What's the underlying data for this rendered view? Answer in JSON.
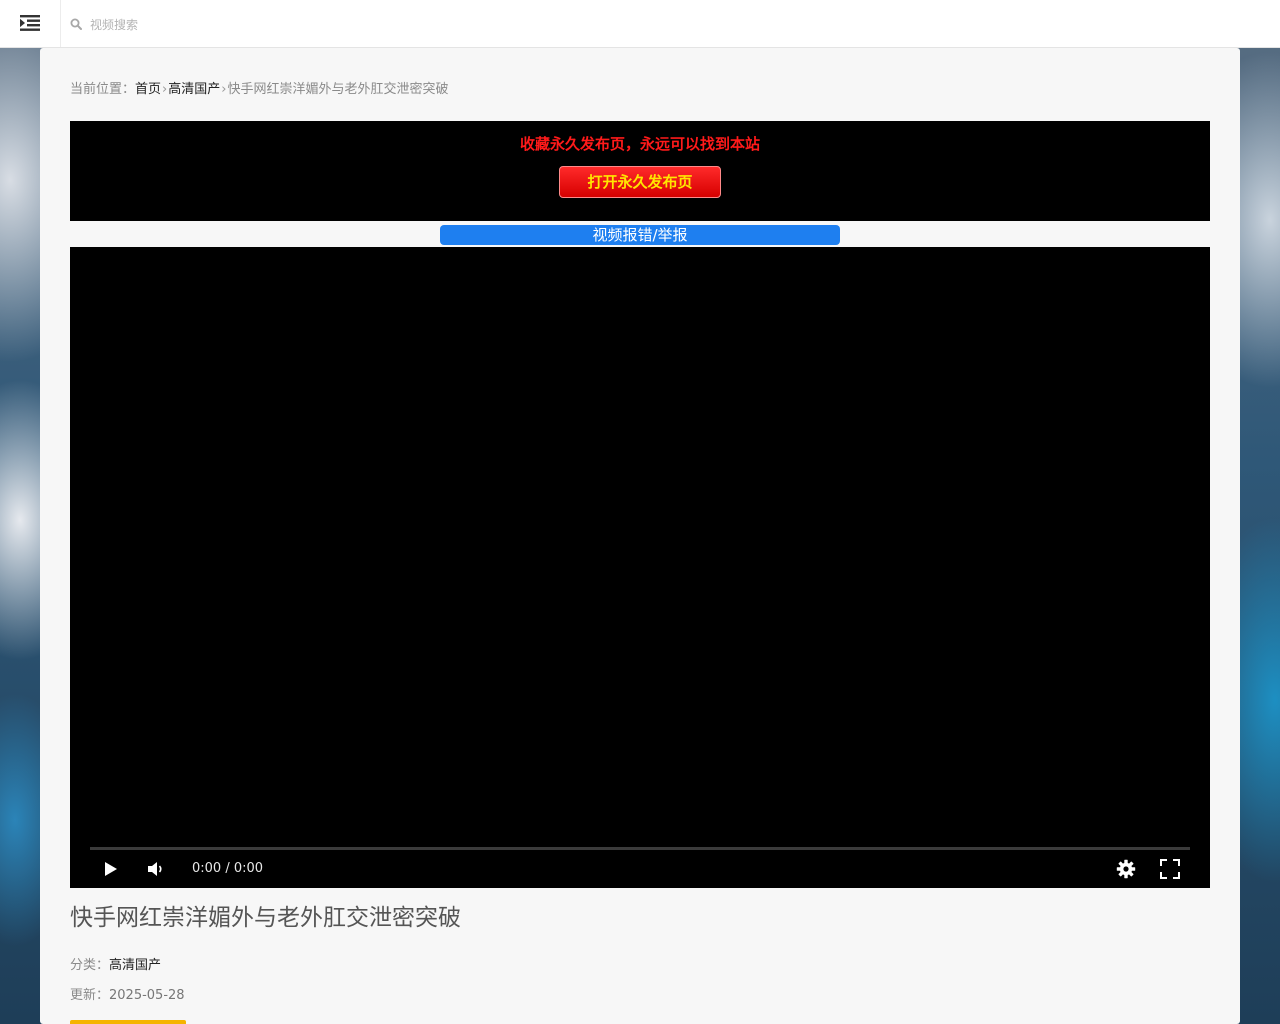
{
  "search": {
    "placeholder": "视频搜索"
  },
  "breadcrumb": {
    "prefix": "当前位置：",
    "home": "首页",
    "separator": "›",
    "category": "高清国产",
    "current": "快手网红崇洋媚外与老外肛交泄密突破"
  },
  "promo": {
    "text": "收藏永久发布页，永远可以找到本站",
    "button_label": "打开永久发布页",
    "text_color": "#ff1a1a",
    "button_text_color": "#ffe600"
  },
  "report": {
    "label": "视频报错/举报",
    "color": "#1e7ff0"
  },
  "player": {
    "time_current": "0:00",
    "time_separator": " / ",
    "time_total": "0:00",
    "progress": 0
  },
  "video": {
    "title": "快手网红崇洋媚外与老外肛交泄密突破",
    "category_label": "分类：",
    "category_value": "高清国产",
    "updated_label": "更新：",
    "updated_value": "2025-05-28"
  }
}
